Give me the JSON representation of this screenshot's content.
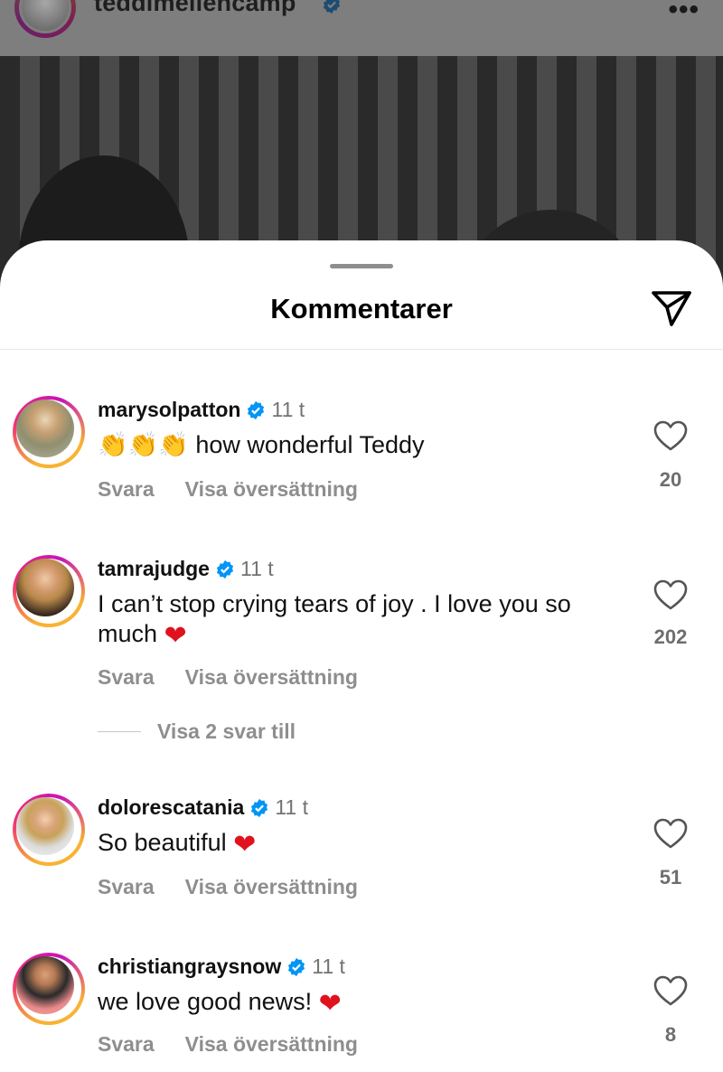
{
  "post": {
    "username": "teddimellencamp",
    "verified": true,
    "more_icon": "more-dots-icon"
  },
  "sheet": {
    "title": "Kommentarer",
    "share_icon": "send-icon"
  },
  "colors": {
    "verified_blue": "#0095f6",
    "secondary_text": "#8e8e8e",
    "heart_red": "#e0121e",
    "story_ring_start": "#f9b233",
    "story_ring_mid": "#ee2a7b"
  },
  "comments": [
    {
      "username": "marysolpatton",
      "verified": true,
      "time": "11 t",
      "emoji_prefix": "👏👏👏",
      "text": "how wonderful Teddy",
      "emoji_suffix": "",
      "reply_label": "Svara",
      "translate_label": "Visa översättning",
      "likes": "20"
    },
    {
      "username": "tamrajudge",
      "verified": true,
      "time": "11 t",
      "emoji_prefix": "",
      "text": "I can’t stop crying tears of joy .  I love you so much",
      "emoji_suffix": "❤",
      "reply_label": "Svara",
      "translate_label": "Visa översättning",
      "likes": "202",
      "more_replies": "Visa 2 svar till"
    },
    {
      "username": "dolorescatania",
      "verified": true,
      "time": "11 t",
      "emoji_prefix": "",
      "text": "So beautiful",
      "emoji_suffix": "❤",
      "reply_label": "Svara",
      "translate_label": "Visa översättning",
      "likes": "51"
    },
    {
      "username": "christiangraysnow",
      "verified": true,
      "time": "11 t",
      "emoji_prefix": "",
      "text": "we love good news!",
      "emoji_suffix": "❤",
      "reply_label": "Svara",
      "translate_label": "Visa översättning",
      "likes": "8"
    }
  ]
}
